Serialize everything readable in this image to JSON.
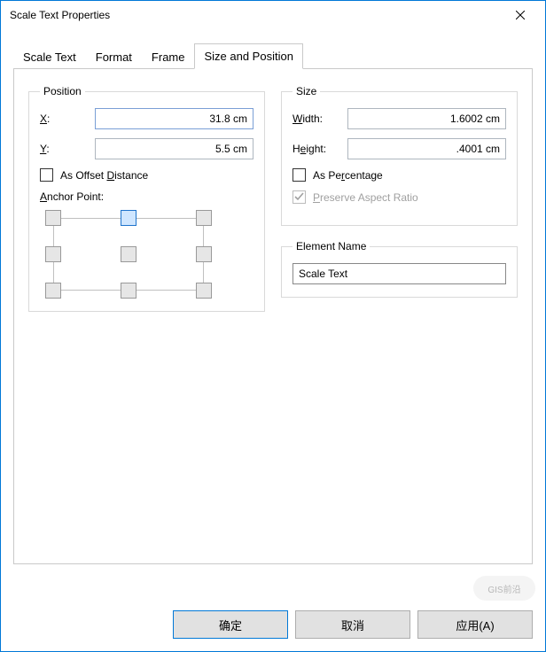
{
  "window": {
    "title": "Scale Text Properties"
  },
  "tabs": [
    {
      "label": "Scale Text",
      "active": false
    },
    {
      "label": "Format",
      "active": false
    },
    {
      "label": "Frame",
      "active": false
    },
    {
      "label": "Size and Position",
      "active": true
    }
  ],
  "position": {
    "legend": "Position",
    "x_label": "X:",
    "x_value": "31.8 cm",
    "y_label": "Y:",
    "y_value": "5.5 cm",
    "offset_label": "As Offset Distance",
    "offset_checked": false,
    "anchor_label": "Anchor Point:",
    "anchor_selected": "top-center"
  },
  "size": {
    "legend": "Size",
    "width_label": "Width:",
    "width_value": "1.6002 cm",
    "height_label": "Height:",
    "height_value": ".4001 cm",
    "percentage_label": "As Percentage",
    "percentage_checked": false,
    "preserve_label": "Preserve Aspect Ratio",
    "preserve_checked": true,
    "preserve_disabled": true
  },
  "element_name": {
    "legend": "Element Name",
    "value": "Scale Text"
  },
  "buttons": {
    "ok": "确定",
    "cancel": "取消",
    "apply": "应用(A)"
  },
  "watermark": "GIS前沿"
}
